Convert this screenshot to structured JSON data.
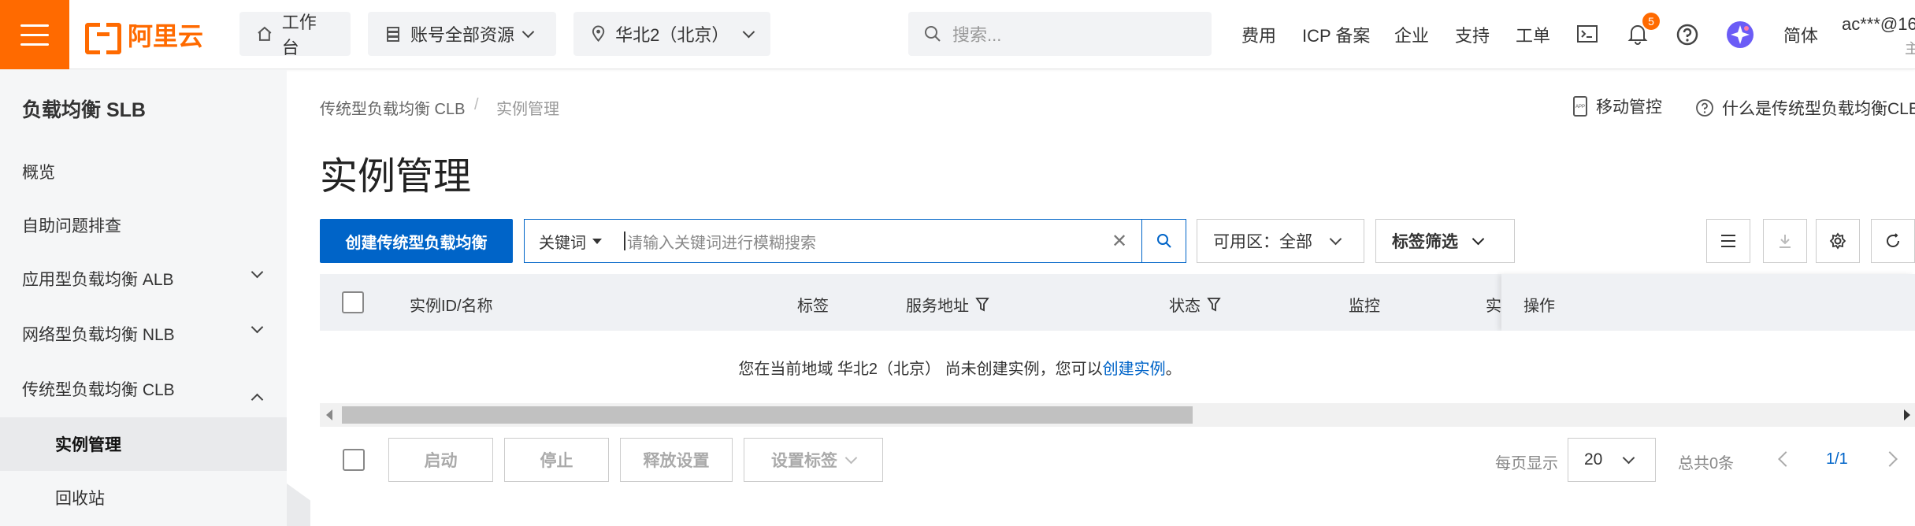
{
  "brand": {
    "name": "阿里云",
    "color": "#ff6a00"
  },
  "topbar": {
    "home": "工作台",
    "resources": "账号全部资源",
    "region": "华北2（北京）",
    "search_placeholder": "搜索...",
    "links": [
      "费用",
      "ICP 备案",
      "企业",
      "支持",
      "工单"
    ],
    "notification_count": "5",
    "lang": "简体",
    "account": "ac***@16",
    "account_sub": "主"
  },
  "sidebar": {
    "title": "负载均衡 SLB",
    "items": [
      {
        "label": "概览"
      },
      {
        "label": "自助问题排查"
      },
      {
        "label": "应用型负载均衡 ALB"
      },
      {
        "label": "网络型负载均衡 NLB"
      },
      {
        "label": "传统型负载均衡 CLB"
      },
      {
        "label": "实例管理"
      },
      {
        "label": "回收站"
      }
    ]
  },
  "breadcrumb": {
    "root": "传统型负载均衡 CLB",
    "sep": "/",
    "current": "实例管理"
  },
  "header_links": {
    "mobile": "移动管控",
    "help": "什么是传统型负载均衡CLB"
  },
  "page_title": "实例管理",
  "toolbar": {
    "create_label": "创建传统型负载均衡",
    "keyword_type": "关键词",
    "search_placeholder": "请输入关键词进行模糊搜索",
    "zone_label": "可用区：",
    "zone_value": "全部",
    "tag_filter": "标签筛选"
  },
  "table": {
    "columns": [
      "实例ID/名称",
      "标签",
      "服务地址",
      "状态",
      "监控",
      "实",
      "操作"
    ],
    "empty_prefix": "您在当前地域 华北2（北京） 尚未创建实例，您可以",
    "empty_link": "创建实例",
    "empty_suffix": "。"
  },
  "actions": {
    "start": "启动",
    "stop": "停止",
    "release": "释放设置",
    "set_tags": "设置标签"
  },
  "pager": {
    "per_page_label": "每页显示",
    "per_page": "20",
    "total": "总共0条",
    "page": "1/1"
  },
  "colors": {
    "primary": "#0064c8",
    "accent": "#ff6a00"
  }
}
